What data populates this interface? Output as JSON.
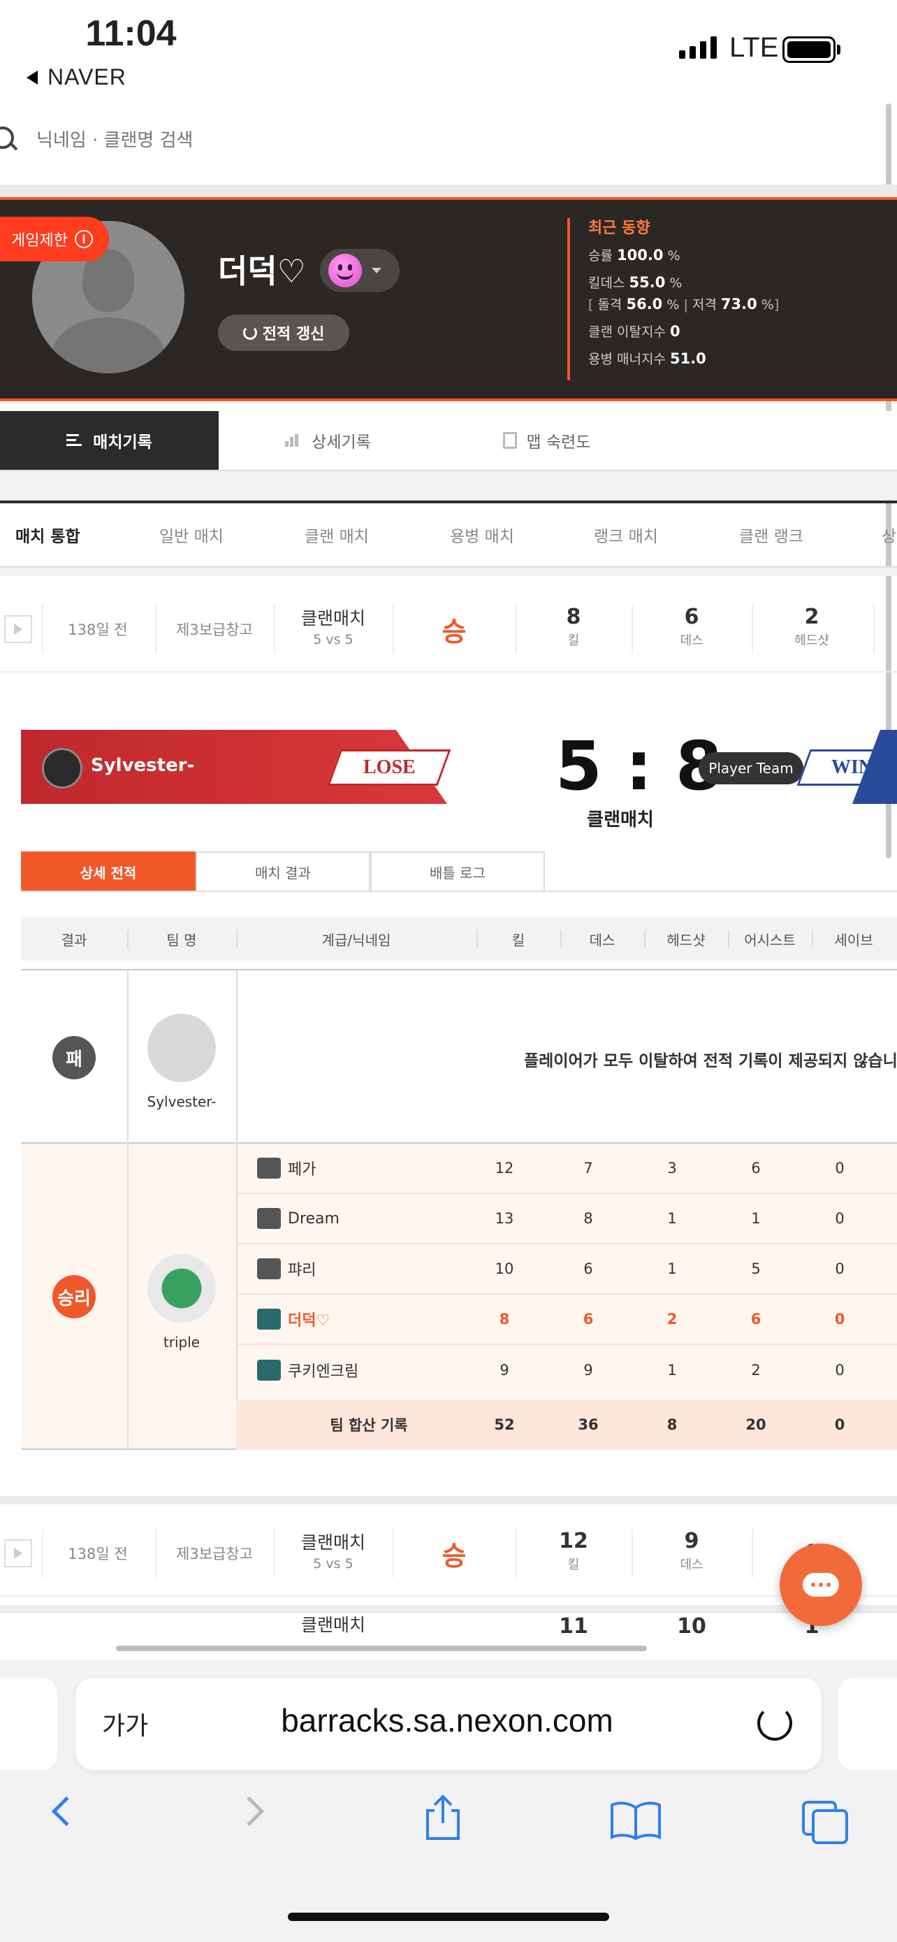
{
  "status_bar": {
    "time": "11:04",
    "back_app": "NAVER",
    "network": "LTE"
  },
  "search": {
    "placeholder": "닉네임 · 클랜명 검색"
  },
  "profile": {
    "restriction_badge": "게임제한",
    "nickname": "더덕♡",
    "refresh_label": "전적 갱신",
    "recent": {
      "title": "최근 동향",
      "win_label": "승률",
      "win_value": "100.0",
      "win_unit": "%",
      "kd_label": "킬데스",
      "kd_value": "55.0",
      "kd_unit": "%",
      "assault_label": "돌격",
      "assault_value": "56.0",
      "assault_unit": "%",
      "sniper_label": "저격",
      "sniper_value": "73.0",
      "sniper_unit": "%",
      "clan_leave_label": "클랜 이탈지수",
      "clan_leave_value": "0",
      "merc_label": "용병 매너지수",
      "merc_value": "51.0"
    }
  },
  "tabs": [
    {
      "label": "매치기록",
      "icon": "list-icon"
    },
    {
      "label": "상세기록",
      "icon": "bar-chart-icon"
    },
    {
      "label": "맵 숙련도",
      "icon": "map-icon"
    }
  ],
  "subtabs": [
    "매치 통합",
    "일반 매치",
    "클랜 매치",
    "용병 매치",
    "랭크 매치",
    "클랜 랭크",
    "상"
  ],
  "matches": [
    {
      "ago": "138일 전",
      "map": "제3보급창고",
      "type": "클랜매치",
      "mode": "5 vs 5",
      "result": "승",
      "kills": "8",
      "kills_label": "킬",
      "deaths": "6",
      "deaths_label": "데스",
      "hs": "2",
      "hs_label": "헤드샷"
    },
    {
      "ago": "138일 전",
      "map": "제3보급창고",
      "type": "클랜매치",
      "mode": "5 vs 5",
      "result": "승",
      "kills": "12",
      "kills_label": "킬",
      "deaths": "9",
      "deaths_label": "데스",
      "hs": "0",
      "hs_label": ""
    },
    {
      "ago": "",
      "map": "",
      "type": "클랜매치",
      "mode": "",
      "result": "",
      "kills": "11",
      "kills_label": "",
      "deaths": "10",
      "deaths_label": "",
      "hs": "1",
      "hs_label": ""
    }
  ],
  "detail": {
    "left_team": "Sylvester-",
    "left_result": "LOSE",
    "score": "5 : 8",
    "score_sub": "클랜매치",
    "right_team": "Player Team",
    "right_result": "WIN",
    "dtabs": [
      "상세 전적",
      "매치 결과",
      "배틀 로그"
    ],
    "headers": [
      "결과",
      "팀 명",
      "계급/닉네임",
      "킬",
      "데스",
      "헤드샷",
      "어시스트",
      "세이브"
    ],
    "lose_row": {
      "result": "패",
      "team": "Sylvester-",
      "message": "플레이어가 모두 이탈하여 전적 기록이 제공되지 않습니다"
    },
    "win_row": {
      "result": "승리",
      "team": "triple",
      "players": [
        {
          "name": "페가",
          "k": "12",
          "d": "7",
          "hs": "3",
          "a": "6",
          "s": "0"
        },
        {
          "name": "Dream",
          "k": "13",
          "d": "8",
          "hs": "1",
          "a": "1",
          "s": "0"
        },
        {
          "name": "퍄리",
          "k": "10",
          "d": "6",
          "hs": "1",
          "a": "5",
          "s": "0"
        },
        {
          "name": "더덕♡",
          "k": "8",
          "d": "6",
          "hs": "2",
          "a": "6",
          "s": "0"
        },
        {
          "name": "쿠키엔크림",
          "k": "9",
          "d": "9",
          "hs": "1",
          "a": "2",
          "s": "0"
        }
      ],
      "total": {
        "label": "팀 합산 기록",
        "k": "52",
        "d": "36",
        "hs": "8",
        "a": "20",
        "s": "0"
      }
    }
  },
  "browser": {
    "text_size": "가가",
    "url": "barracks.sa.nexon.com"
  },
  "colors": {
    "accent": "#f0582a",
    "lose": "#c0282d",
    "win": "#2a4a9a",
    "dark": "#2a2725"
  }
}
